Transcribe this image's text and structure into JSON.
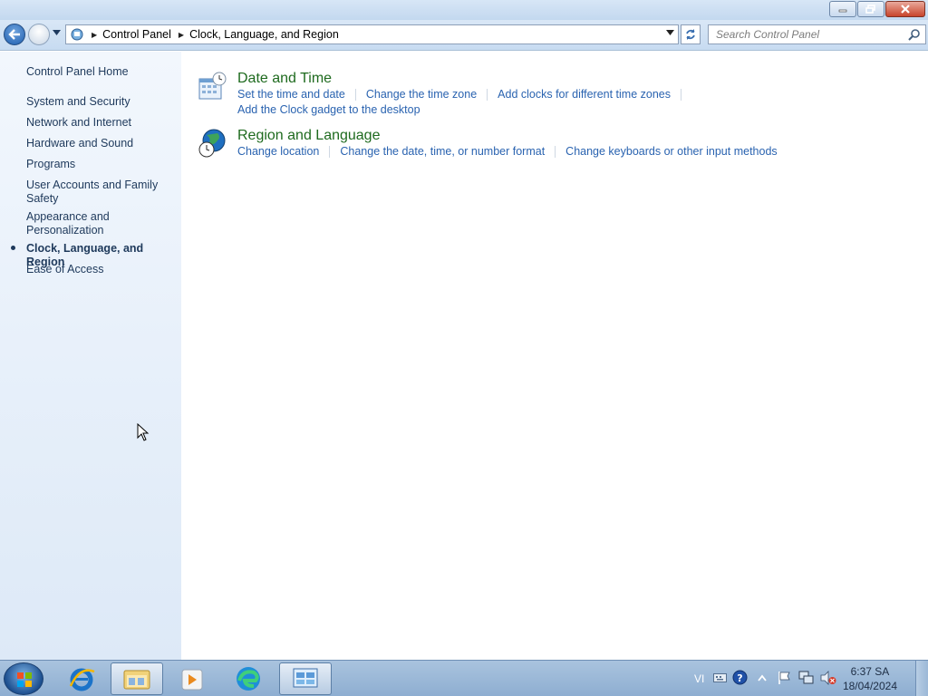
{
  "window": {
    "controls": [
      "minimize",
      "restore",
      "close"
    ]
  },
  "address_bar": {
    "breadcrumbs": [
      "Control Panel",
      "Clock, Language, and Region"
    ]
  },
  "search": {
    "placeholder": "Search Control Panel"
  },
  "sidebar": {
    "items": [
      {
        "label": "Control Panel Home",
        "current": false
      },
      {
        "label": "System and Security",
        "current": false
      },
      {
        "label": "Network and Internet",
        "current": false
      },
      {
        "label": "Hardware and Sound",
        "current": false
      },
      {
        "label": "Programs",
        "current": false
      },
      {
        "label": "User Accounts and Family Safety",
        "current": false
      },
      {
        "label": "Appearance and Personalization",
        "current": false
      },
      {
        "label": "Clock, Language, and Region",
        "current": true
      },
      {
        "label": "Ease of Access",
        "current": false
      }
    ]
  },
  "main": {
    "categories": [
      {
        "title": "Date and Time",
        "icon": "calendar-clock-icon",
        "links": [
          "Set the time and date",
          "Change the time zone",
          "Add clocks for different time zones",
          "Add the Clock gadget to the desktop"
        ]
      },
      {
        "title": "Region and Language",
        "icon": "globe-clock-icon",
        "links": [
          "Change location",
          "Change the date, time, or number format",
          "Change keyboards or other input methods"
        ]
      }
    ]
  },
  "taskbar": {
    "pinned": [
      "start-orb",
      "internet-explorer-icon",
      "windows-explorer-icon",
      "media-player-icon",
      "edge-icon",
      "control-panel-icon"
    ],
    "tray": {
      "language": "VI",
      "time": "6:37 SA",
      "date": "18/04/2024"
    }
  },
  "colors": {
    "link": "#2a63b0",
    "category_title": "#1e6a1e",
    "sidebar_text": "#1e395b"
  }
}
